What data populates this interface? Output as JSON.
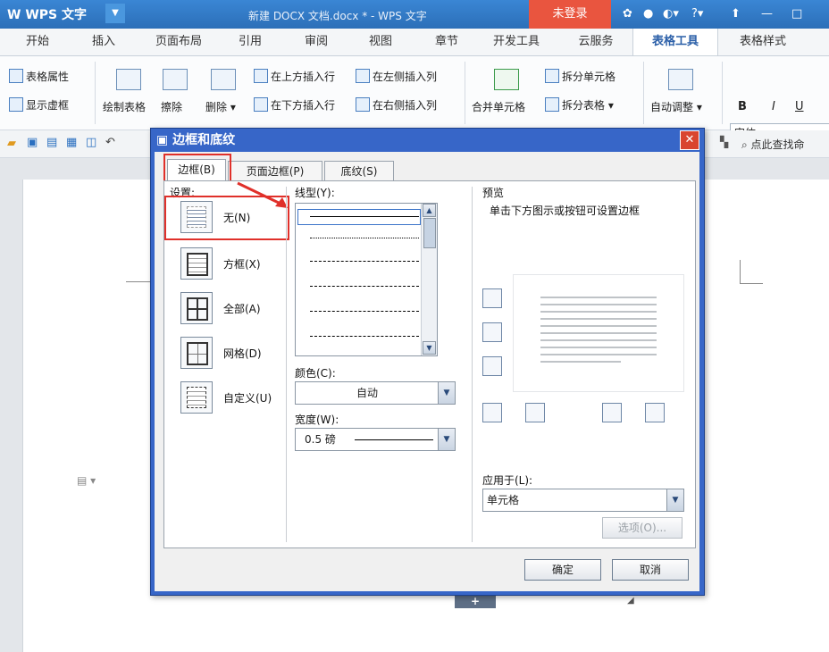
{
  "app": {
    "logo": "W WPS 文字",
    "doc_title": "新建 DOCX 文档.docx * - WPS 文字",
    "login": "未登录"
  },
  "menu": {
    "tabs": [
      "开始",
      "插入",
      "页面布局",
      "引用",
      "审阅",
      "视图",
      "章节",
      "开发工具",
      "云服务",
      "表格工具",
      "表格样式"
    ],
    "active": "表格工具"
  },
  "ribbon": {
    "table_props": "表格属性",
    "show_gridlines": "显示虚框",
    "draw_table": "绘制表格",
    "erase": "擦除",
    "delete": "删除",
    "insert_above": "在上方插入行",
    "insert_below": "在下方插入行",
    "insert_left": "在左侧插入列",
    "insert_right": "在右侧插入列",
    "merge_cells": "合并单元格",
    "split_cells": "拆分单元格",
    "split_table": "拆分表格",
    "auto_fit": "自动调整",
    "font": "宋体",
    "bold": "B",
    "italic": "I",
    "underline": "U"
  },
  "quickbar": {
    "search": "点此查找命"
  },
  "dialog": {
    "title": "边框和底纹",
    "tabs": [
      "边框(B)",
      "页面边框(P)",
      "底纹(S)"
    ],
    "settings_label": "设置:",
    "settings": [
      "无(N)",
      "方框(X)",
      "全部(A)",
      "网格(D)",
      "自定义(U)"
    ],
    "line_style_label": "线型(Y):",
    "color_label": "颜色(C):",
    "color_value": "自动",
    "width_label": "宽度(W):",
    "width_value": "0.5 磅",
    "preview_label": "预览",
    "preview_hint": "单击下方图示或按钮可设置边框",
    "apply_label": "应用于(L):",
    "apply_value": "单元格",
    "options_btn": "选项(O)...",
    "ok": "确定",
    "cancel": "取消"
  }
}
